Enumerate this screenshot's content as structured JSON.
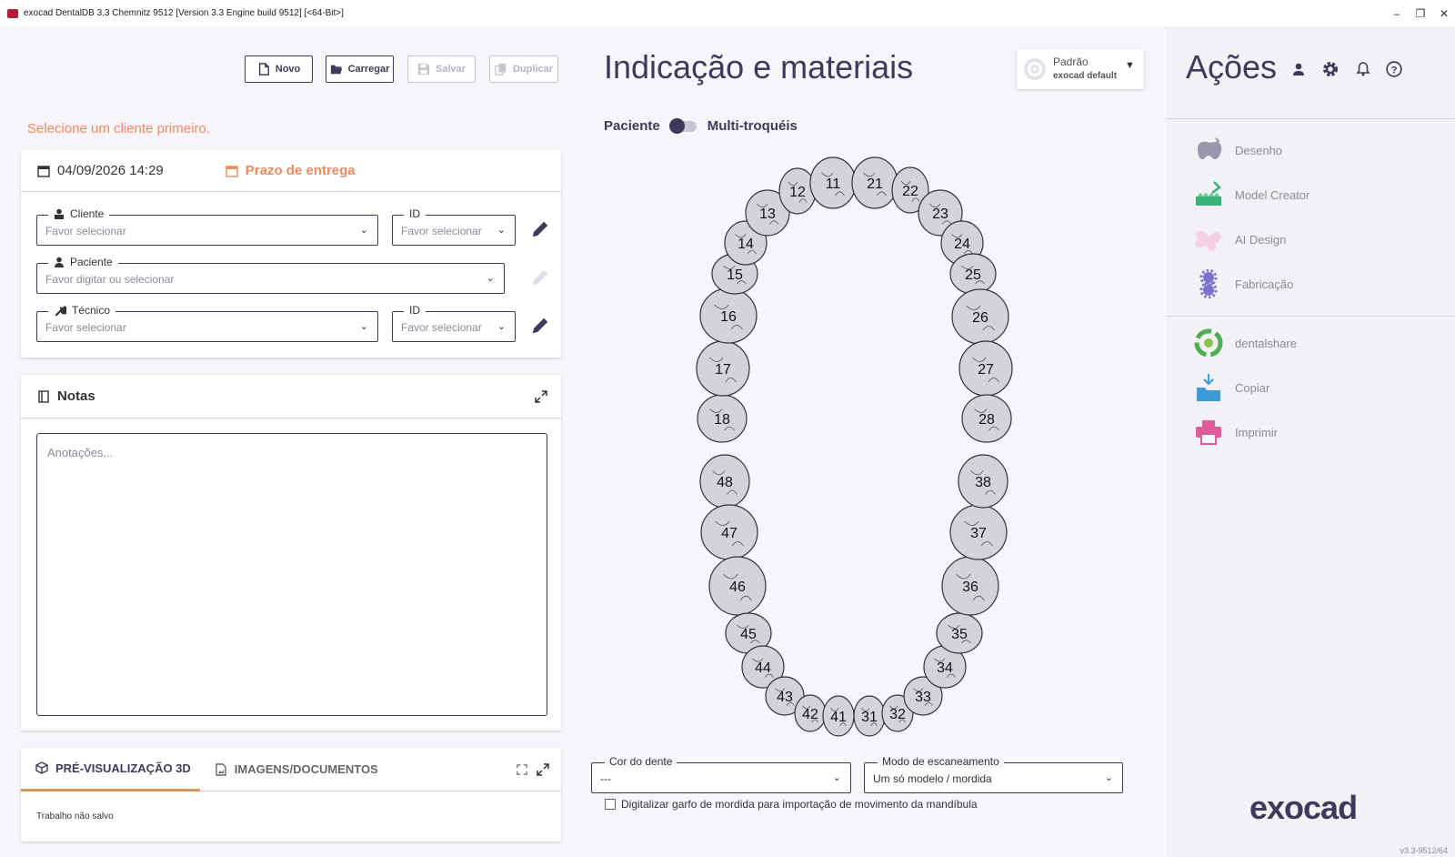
{
  "window": {
    "title": "exocad DentalDB 3.3 Chemnitz 9512 [Version 3.3 Engine build 9512] [<64-Bit>]",
    "minimize": "–",
    "maximize": "❐",
    "close": "✕"
  },
  "toolbar": {
    "novo": "Novo",
    "carregar": "Carregar",
    "salvar": "Salvar",
    "duplicar": "Duplicar"
  },
  "warning": "Selecione um cliente primeiro.",
  "order": {
    "datetime": "04/09/2026 14:29",
    "deadline_label": "Prazo de entrega",
    "cliente": {
      "label": "Cliente",
      "placeholder": "Favor selecionar"
    },
    "cliente_id": {
      "label": "ID",
      "placeholder": "Favor selecionar"
    },
    "paciente": {
      "label": "Paciente",
      "placeholder": "Favor digitar ou selecionar"
    },
    "tecnico": {
      "label": "Técnico",
      "placeholder": "Favor selecionar"
    },
    "tecnico_id": {
      "label": "ID",
      "placeholder": "Favor selecionar"
    }
  },
  "notes": {
    "title": "Notas",
    "placeholder": "Anotações..."
  },
  "preview": {
    "tab_3d": "PRÉ-VISUALIZAÇÃO 3D",
    "tab_docs": "IMAGENS/DOCUMENTOS",
    "status": "Trabalho não salvo"
  },
  "center": {
    "title": "Indicação e materiais",
    "preset_label": "Padrão",
    "preset_value": "exocad default",
    "toggle_left": "Paciente",
    "toggle_right": "Multi-troquéis",
    "teeth_upper": [
      "18",
      "17",
      "16",
      "15",
      "14",
      "13",
      "12",
      "11",
      "21",
      "22",
      "23",
      "24",
      "25",
      "26",
      "27",
      "28"
    ],
    "teeth_lower": [
      "48",
      "47",
      "46",
      "45",
      "44",
      "43",
      "42",
      "41",
      "31",
      "32",
      "33",
      "34",
      "35",
      "36",
      "37",
      "38"
    ],
    "tooth_color": {
      "label": "Cor do dente",
      "value": "---"
    },
    "scan_mode": {
      "label": "Modo de escaneamento",
      "value": "Um só modelo / mordida"
    },
    "checkbox_label": "Digitalizar garfo de mordida para importação de movimento da mandíbula"
  },
  "actions": {
    "title": "Ações",
    "items": [
      {
        "label": "Desenho",
        "icon": "design-tooth-icon",
        "color": "#9a96ad"
      },
      {
        "label": "Model Creator",
        "icon": "model-creator-icon",
        "color": "#3bb27a"
      },
      {
        "label": "AI Design",
        "icon": "ai-design-icon",
        "color": "#f1b8d6"
      },
      {
        "label": "Fabricação",
        "icon": "fabrication-gear-icon",
        "color": "#7b73c9"
      },
      {
        "label": "dentalshare",
        "icon": "dentalshare-icon",
        "color": "#4caf50"
      },
      {
        "label": "Copiar",
        "icon": "copy-folder-icon",
        "color": "#3a9bd5"
      },
      {
        "label": "Imprimir",
        "icon": "printer-icon",
        "color": "#e15a9e"
      }
    ],
    "logo": "exocad",
    "version": "v3.3-9512/64"
  },
  "colors": {
    "accent": "#f08a5d",
    "primary": "#3e3a5c"
  }
}
